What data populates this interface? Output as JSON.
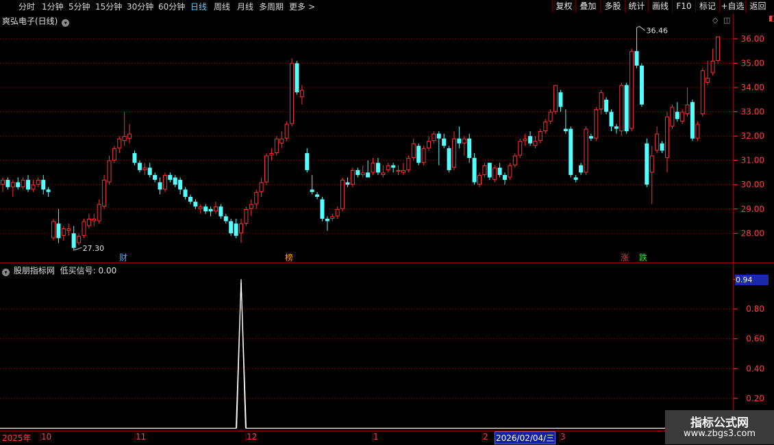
{
  "toolbar": {
    "periods": [
      "分时",
      "1分钟",
      "5分钟",
      "15分钟",
      "30分钟",
      "60分钟",
      "日线",
      "周线",
      "月线",
      "多周期",
      "更多"
    ],
    "active_period": "日线",
    "more_chevron": ">",
    "buttons": [
      "复权",
      "叠加",
      "多股",
      "统计",
      "画线",
      "F10",
      "标记",
      "+自选",
      "返回"
    ]
  },
  "main_chart": {
    "title": "爽弘电子(日线)",
    "title_menu_icon": "chevron-down-icon",
    "price_axis_labels": [
      "36.00",
      "35.00",
      "34.00",
      "33.00",
      "32.00",
      "31.00",
      "30.00",
      "29.00",
      "28.00"
    ],
    "high_marker": "36.46",
    "low_marker": "27.30",
    "event_tags": [
      {
        "text": "财",
        "color": "#4aa8ff"
      },
      {
        "text": "榜",
        "color": "#ff9a20"
      },
      {
        "text": "涨",
        "color": "#ff3030"
      },
      {
        "text": "跌",
        "color": "#30e030"
      }
    ]
  },
  "indicator_panel": {
    "source": "股朋指标网",
    "signal_label": "低买信号:",
    "signal_value": "0.00",
    "current_value": "0.94",
    "axis_labels": [
      "0.80",
      "0.60",
      "0.40",
      "0.20"
    ]
  },
  "date_axis": {
    "labels": [
      "2025年",
      "10",
      "11",
      "12",
      "1",
      "2",
      "3"
    ],
    "selected_date": "2026/02/04/三"
  },
  "watermark": {
    "line1": "指标公式网",
    "line2": "www.zbgs3.com"
  },
  "colors": {
    "up": "#ff3232",
    "down": "#54ffff",
    "grid": "#8b0000",
    "indicator_line": "#ffffff",
    "axis_text": "#ff4040"
  },
  "chart_data": {
    "type": "candlestick",
    "ylim": [
      27.3,
      36.46
    ],
    "y_ticks": [
      28,
      29,
      30,
      31,
      32,
      33,
      34,
      35,
      36
    ],
    "candles": [
      [
        30.0,
        30.3,
        29.7,
        30.2
      ],
      [
        30.2,
        30.3,
        29.8,
        29.9
      ],
      [
        29.9,
        30.2,
        29.5,
        30.1
      ],
      [
        30.1,
        30.3,
        29.8,
        29.9
      ],
      [
        29.9,
        30.3,
        29.8,
        30.2
      ],
      [
        30.2,
        30.4,
        29.7,
        29.8
      ],
      [
        29.8,
        30.2,
        29.7,
        30.0
      ],
      [
        30.0,
        30.3,
        29.9,
        30.2
      ],
      [
        30.2,
        30.4,
        29.6,
        29.8
      ],
      [
        29.8,
        29.9,
        29.5,
        29.7
      ],
      [
        27.8,
        28.6,
        27.7,
        28.5
      ],
      [
        28.4,
        29.0,
        27.6,
        27.8
      ],
      [
        27.9,
        28.3,
        27.7,
        28.2
      ],
      [
        28.1,
        28.4,
        27.9,
        28.2
      ],
      [
        28.0,
        28.3,
        27.3,
        27.4
      ],
      [
        27.6,
        28.0,
        27.5,
        27.9
      ],
      [
        27.9,
        28.6,
        27.8,
        28.5
      ],
      [
        28.3,
        28.8,
        28.2,
        28.6
      ],
      [
        28.5,
        28.8,
        28.3,
        28.6
      ],
      [
        28.5,
        29.4,
        28.4,
        29.2
      ],
      [
        29.1,
        30.4,
        29.0,
        30.2
      ],
      [
        30.1,
        31.2,
        30.0,
        31.0
      ],
      [
        31.0,
        31.6,
        30.9,
        31.5
      ],
      [
        31.5,
        32.0,
        31.3,
        31.9
      ],
      [
        31.8,
        33.0,
        31.6,
        32.0
      ],
      [
        31.9,
        32.5,
        31.7,
        32.1
      ],
      [
        31.3,
        31.4,
        30.8,
        30.9
      ],
      [
        30.9,
        31.0,
        30.5,
        30.6
      ],
      [
        30.6,
        30.9,
        30.4,
        30.7
      ],
      [
        30.7,
        30.9,
        30.3,
        30.4
      ],
      [
        30.4,
        30.5,
        30.1,
        30.2
      ],
      [
        30.1,
        30.3,
        29.6,
        29.8
      ],
      [
        29.8,
        30.5,
        29.7,
        30.4
      ],
      [
        30.4,
        30.5,
        30.1,
        30.2
      ],
      [
        30.3,
        30.4,
        29.9,
        30.0
      ],
      [
        30.2,
        30.3,
        29.6,
        29.8
      ],
      [
        29.8,
        29.9,
        29.4,
        29.5
      ],
      [
        29.5,
        29.6,
        29.2,
        29.3
      ],
      [
        29.3,
        29.4,
        29.0,
        29.1
      ],
      [
        29.0,
        29.2,
        28.8,
        29.1
      ],
      [
        29.1,
        29.2,
        28.8,
        28.9
      ],
      [
        29.0,
        29.1,
        28.7,
        28.9
      ],
      [
        28.9,
        29.3,
        28.8,
        29.1
      ],
      [
        29.1,
        29.2,
        28.6,
        28.7
      ],
      [
        28.7,
        28.8,
        28.4,
        28.5
      ],
      [
        28.5,
        28.6,
        27.9,
        28.0
      ],
      [
        28.4,
        28.6,
        27.8,
        27.9
      ],
      [
        28.0,
        28.6,
        27.6,
        28.4
      ],
      [
        28.4,
        29.1,
        28.3,
        29.0
      ],
      [
        29.0,
        29.4,
        28.7,
        29.2
      ],
      [
        29.2,
        29.8,
        29.0,
        29.7
      ],
      [
        29.7,
        30.3,
        29.5,
        30.1
      ],
      [
        30.1,
        31.3,
        30.0,
        31.2
      ],
      [
        31.2,
        31.5,
        31.0,
        31.3
      ],
      [
        31.3,
        32.0,
        31.2,
        31.9
      ],
      [
        31.7,
        32.2,
        31.5,
        31.9
      ],
      [
        31.9,
        32.6,
        31.8,
        32.5
      ],
      [
        32.5,
        35.2,
        32.4,
        35.0
      ],
      [
        35.0,
        35.1,
        33.7,
        33.8
      ],
      [
        33.6,
        34.1,
        33.3,
        33.9
      ],
      [
        31.3,
        31.5,
        30.5,
        30.6
      ],
      [
        29.8,
        30.4,
        29.6,
        29.7
      ],
      [
        29.6,
        29.7,
        29.4,
        29.5
      ],
      [
        29.4,
        29.5,
        28.5,
        28.6
      ],
      [
        28.6,
        28.7,
        28.1,
        28.5
      ],
      [
        28.6,
        28.8,
        28.5,
        28.7
      ],
      [
        28.7,
        29.1,
        28.6,
        29.0
      ],
      [
        29.0,
        30.3,
        28.9,
        30.2
      ],
      [
        30.1,
        30.3,
        29.9,
        30.0
      ],
      [
        30.0,
        30.7,
        29.9,
        30.6
      ],
      [
        30.6,
        30.7,
        30.3,
        30.4
      ],
      [
        30.4,
        30.8,
        30.3,
        30.5
      ],
      [
        30.5,
        31.0,
        30.3,
        30.3
      ],
      [
        30.5,
        31.1,
        30.4,
        30.9
      ],
      [
        30.9,
        31.1,
        30.4,
        30.5
      ],
      [
        30.4,
        30.8,
        30.3,
        30.5
      ],
      [
        30.6,
        30.9,
        30.5,
        30.8
      ],
      [
        30.8,
        30.9,
        30.5,
        30.7
      ],
      [
        30.6,
        30.8,
        30.4,
        30.6
      ],
      [
        30.5,
        30.9,
        30.4,
        30.6
      ],
      [
        30.6,
        31.2,
        30.5,
        31.1
      ],
      [
        31.1,
        31.9,
        31.0,
        31.7
      ],
      [
        31.6,
        31.7,
        30.8,
        30.9
      ],
      [
        30.9,
        31.6,
        30.8,
        31.5
      ],
      [
        31.5,
        32.0,
        31.4,
        31.8
      ],
      [
        31.8,
        32.2,
        31.7,
        32.1
      ],
      [
        32.1,
        32.2,
        30.8,
        31.9
      ],
      [
        31.9,
        32.1,
        31.5,
        31.6
      ],
      [
        31.5,
        31.6,
        30.5,
        30.6
      ],
      [
        30.7,
        32.2,
        30.6,
        31.9
      ],
      [
        31.9,
        32.4,
        31.5,
        31.7
      ],
      [
        31.7,
        32.0,
        31.2,
        31.9
      ],
      [
        31.9,
        32.1,
        30.9,
        31.1
      ],
      [
        31.1,
        31.3,
        30.0,
        30.1
      ],
      [
        30.0,
        30.5,
        29.9,
        30.4
      ],
      [
        30.4,
        30.9,
        30.3,
        30.8
      ],
      [
        30.9,
        30.9,
        30.2,
        30.3
      ],
      [
        30.2,
        30.8,
        30.1,
        30.7
      ],
      [
        30.7,
        30.9,
        30.3,
        30.4
      ],
      [
        30.4,
        30.5,
        30.0,
        30.2
      ],
      [
        30.3,
        30.9,
        30.2,
        30.8
      ],
      [
        30.8,
        31.3,
        30.7,
        31.2
      ],
      [
        31.2,
        31.9,
        31.1,
        31.8
      ],
      [
        31.8,
        32.1,
        31.6,
        31.9
      ],
      [
        32.0,
        32.2,
        31.6,
        31.7
      ],
      [
        31.6,
        32.0,
        31.5,
        31.8
      ],
      [
        31.8,
        32.3,
        31.7,
        32.2
      ],
      [
        32.2,
        32.7,
        32.1,
        32.6
      ],
      [
        32.6,
        33.1,
        32.5,
        33.0
      ],
      [
        33.0,
        34.1,
        32.9,
        34.1
      ],
      [
        33.8,
        33.9,
        33.0,
        33.2
      ],
      [
        32.3,
        33.1,
        32.1,
        32.2
      ],
      [
        32.3,
        32.4,
        30.3,
        30.4
      ],
      [
        30.3,
        30.4,
        30.1,
        30.2
      ],
      [
        30.8,
        30.9,
        30.4,
        30.5
      ],
      [
        30.5,
        32.4,
        30.4,
        32.3
      ],
      [
        32.0,
        32.1,
        31.8,
        31.9
      ],
      [
        31.9,
        33.2,
        31.8,
        33.1
      ],
      [
        33.1,
        33.9,
        32.9,
        33.8
      ],
      [
        33.5,
        33.6,
        32.9,
        33.0
      ],
      [
        33.0,
        33.1,
        32.2,
        32.4
      ],
      [
        32.4,
        32.5,
        32.1,
        32.3
      ],
      [
        32.2,
        34.2,
        32.0,
        34.1
      ],
      [
        34.1,
        34.2,
        32.1,
        32.2
      ],
      [
        32.3,
        35.6,
        32.2,
        35.5
      ],
      [
        35.5,
        36.46,
        34.8,
        34.9
      ],
      [
        34.9,
        35.0,
        33.2,
        33.3
      ],
      [
        31.7,
        31.9,
        29.9,
        30.0
      ],
      [
        30.5,
        31.6,
        29.2,
        31.2
      ],
      [
        31.4,
        32.4,
        31.3,
        32.1
      ],
      [
        31.7,
        31.8,
        31.3,
        31.4
      ],
      [
        31.1,
        33.0,
        30.5,
        32.8
      ],
      [
        32.4,
        33.3,
        32.3,
        33.2
      ],
      [
        33.0,
        33.4,
        32.6,
        32.7
      ],
      [
        32.6,
        33.1,
        32.5,
        33.0
      ],
      [
        32.9,
        34.0,
        32.8,
        33.3
      ],
      [
        33.4,
        33.5,
        31.8,
        31.9
      ],
      [
        31.9,
        32.6,
        31.8,
        32.5
      ],
      [
        32.9,
        34.8,
        32.8,
        34.7
      ],
      [
        34.2,
        35.1,
        34.1,
        34.4
      ],
      [
        34.6,
        35.6,
        34.5,
        35.1
      ],
      [
        35.1,
        36.1,
        35.0,
        36.1
      ]
    ],
    "indicator_series": {
      "name": "低买信号",
      "ylim": [
        0,
        1
      ],
      "spike_index": 47,
      "spike_value": 1.0
    }
  }
}
